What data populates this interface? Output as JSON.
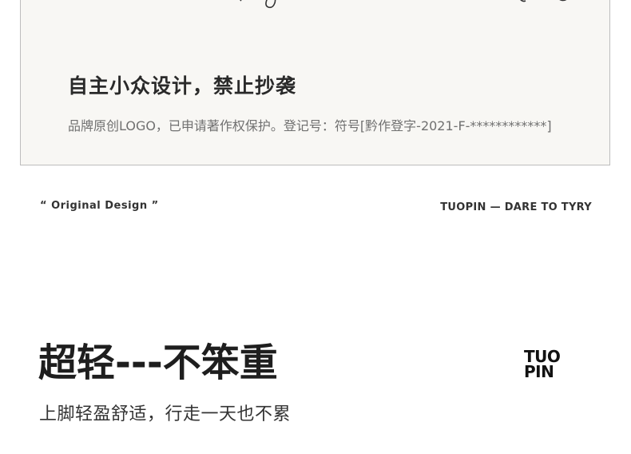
{
  "card": {
    "title": "自主小众设计，禁止抄袭",
    "subtitle": "品牌原创LOGO，已申请著作权保护。登记号：符号[黔作登字-2021-F-************]"
  },
  "tags": {
    "left": "“ Original Design ”",
    "right": "TUOPIN — DARE TO TYRY"
  },
  "feature": {
    "headline": "超轻---不笨重",
    "subline": "上脚轻盈舒适，行走一天也不累"
  },
  "brand_logo": {
    "line1": "TUO",
    "line2": "PIN"
  }
}
